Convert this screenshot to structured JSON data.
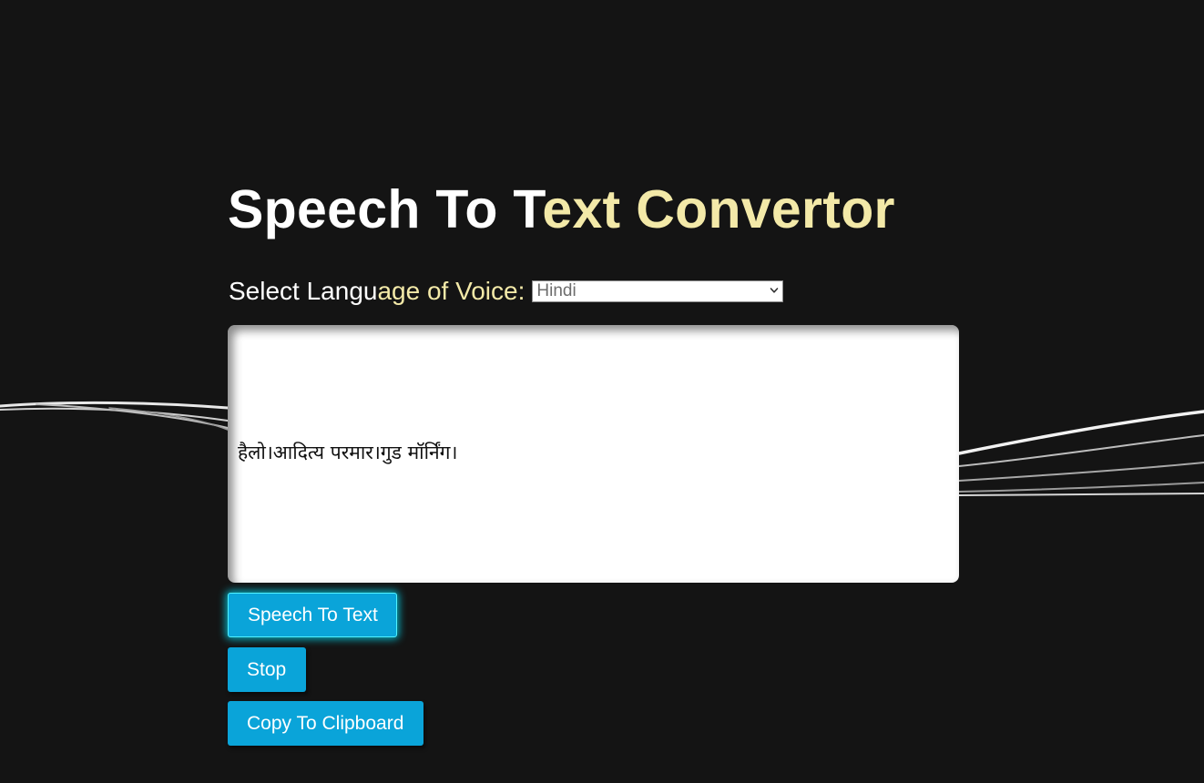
{
  "header": {
    "title_part1": "Speech To T",
    "title_part2": "ext Convertor"
  },
  "language": {
    "label_part1": "Select Langu",
    "label_part2": "age of Voice:",
    "selected": "Hindi",
    "chevron_icon": "chevron-down-icon"
  },
  "output": {
    "text": "हैलो।आदित्य परमार।गुड मॉर्निंग।"
  },
  "buttons": {
    "speech_to_text": "Speech To Text",
    "stop": "Stop",
    "copy": "Copy To Clipboard"
  },
  "colors": {
    "background": "#141414",
    "accent_text": "#f3e9a8",
    "button": "#0aa4d9",
    "button_glow": "#4ff1ff"
  }
}
